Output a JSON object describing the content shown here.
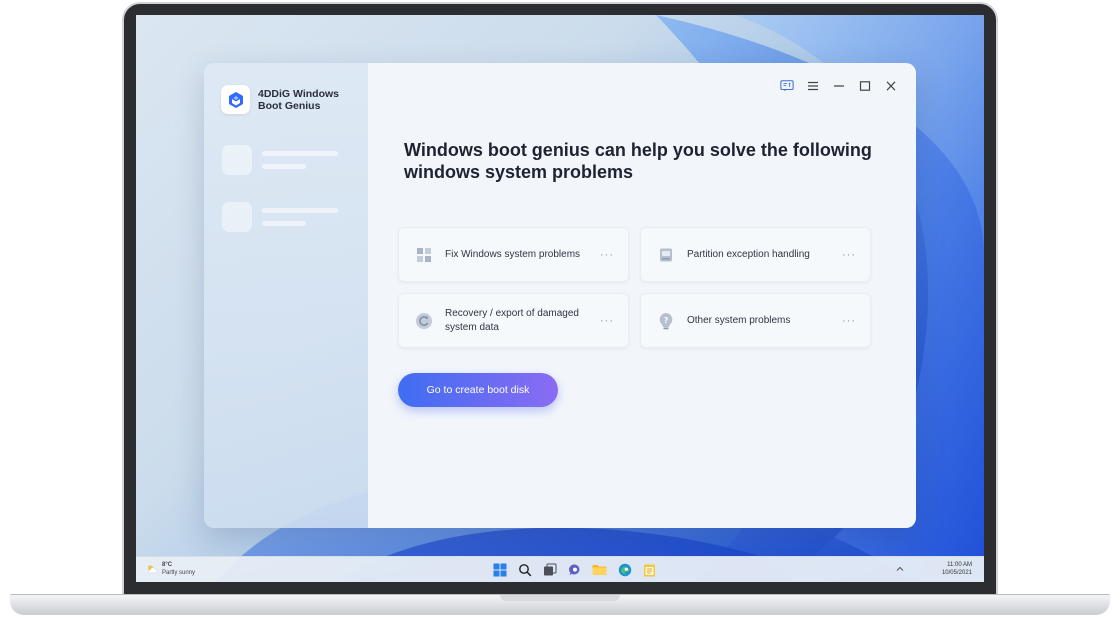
{
  "app": {
    "name": "4DDiG Windows\nBoot Genius"
  },
  "main": {
    "headline": "Windows boot genius can help you solve the following windows system problems",
    "cards": [
      {
        "label": "Fix Windows system problems",
        "more": "···"
      },
      {
        "label": "Partition exception handling",
        "more": "···"
      },
      {
        "label": "Recovery / export of damaged system data",
        "more": "···"
      },
      {
        "label": "Other system problems",
        "more": "···"
      }
    ],
    "cta_label": "Go to create boot disk"
  },
  "taskbar": {
    "weather_temp": "8°C",
    "weather_desc": "Partly sunny",
    "time": "11:00 AM",
    "date": "10/05/2021"
  },
  "colors": {
    "accent_start": "#3f6df2",
    "accent_end": "#8a6cf2",
    "logo_blue": "#2f6bff"
  },
  "icons": {
    "window_controls": [
      "feedback-icon",
      "menu-icon",
      "minimize-icon",
      "maximize-icon",
      "close-icon"
    ],
    "cards": [
      "windows-grid-icon",
      "partition-disk-icon",
      "data-recovery-icon",
      "question-bulb-icon"
    ],
    "taskbar": [
      "windows-start-icon",
      "search-icon",
      "task-view-icon",
      "chat-icon",
      "file-explorer-icon",
      "edge-browser-icon",
      "notepad-icon"
    ]
  }
}
